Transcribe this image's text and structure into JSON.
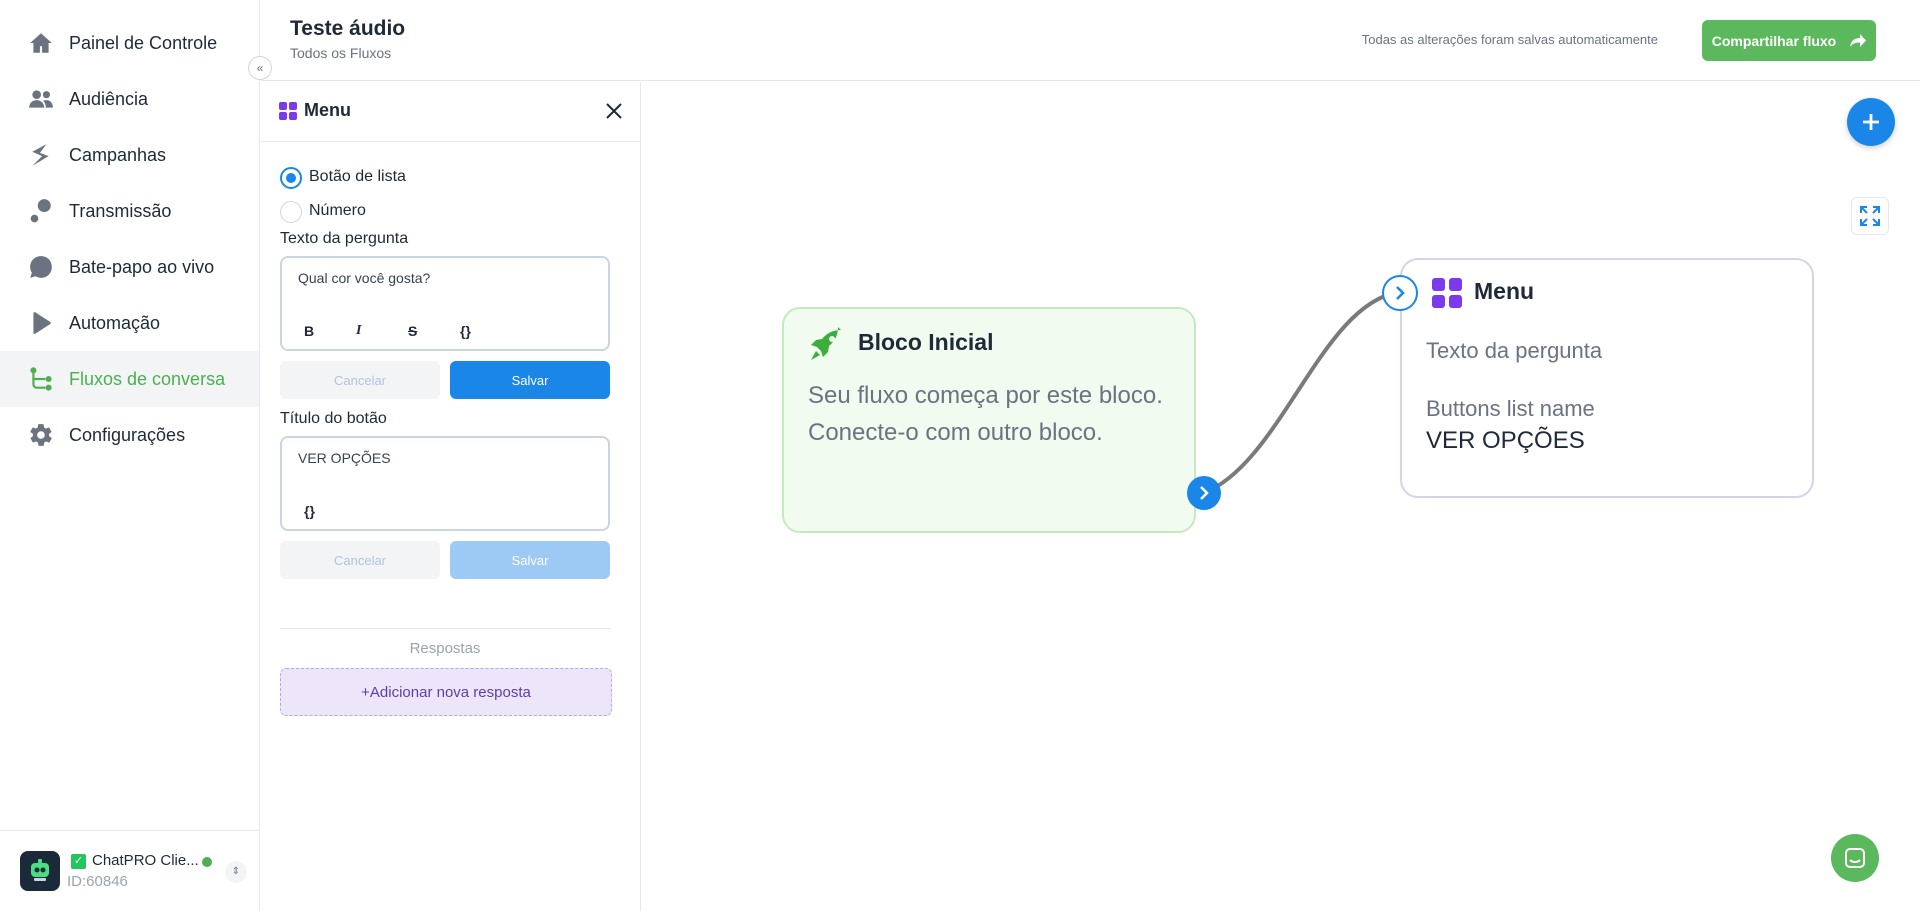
{
  "sidebar": {
    "items": [
      {
        "label": "Painel de Controle",
        "icon": "home-icon"
      },
      {
        "label": "Audiência",
        "icon": "people-icon"
      },
      {
        "label": "Campanhas",
        "icon": "campaigns-icon"
      },
      {
        "label": "Transmissão",
        "icon": "broadcast-icon"
      },
      {
        "label": "Bate-papo ao vivo",
        "icon": "chat-bubble-icon"
      },
      {
        "label": "Automação",
        "icon": "automation-icon"
      },
      {
        "label": "Fluxos de conversa",
        "icon": "flow-icon",
        "active": true
      },
      {
        "label": "Configurações",
        "icon": "gear-icon"
      }
    ],
    "account": {
      "name": "ChatPRO Clie...",
      "id": "ID:60846",
      "status_color": "#4caf50"
    }
  },
  "header": {
    "title": "Teste áudio",
    "breadcrumb": "Todos os Fluxos",
    "save_status": "Todas as alterações foram salvas automaticamente",
    "share_label": "Compartilhar fluxo"
  },
  "panel": {
    "title": "Menu",
    "options": {
      "list_button": "Botão de lista",
      "number": "Número",
      "selected": "Botão de lista"
    },
    "question": {
      "label": "Texto da pergunta",
      "value": "Qual cor você gosta?",
      "format_buttons": [
        "B",
        "I",
        "S",
        "{}"
      ],
      "cancel": "Cancelar",
      "save": "Salvar"
    },
    "button_title": {
      "label": "Título do botão",
      "value": "VER OPÇÕES",
      "format_buttons": [
        "{}"
      ],
      "cancel": "Cancelar",
      "save": "Salvar"
    },
    "responses_label": "Respostas",
    "add_response": "+Adicionar nova resposta"
  },
  "canvas": {
    "start_node": {
      "title": "Bloco Inicial",
      "description": "Seu fluxo começa por este bloco. Conecte-o com outro bloco."
    },
    "menu_node": {
      "title": "Menu",
      "question_label": "Texto da pergunta",
      "buttons_list_label": "Buttons list name",
      "buttons_list_value": "VER OPÇÕES"
    }
  },
  "colors": {
    "primary": "#1a86e8",
    "brand_green": "#5cb85c",
    "menu_purple": "#7c3aed"
  }
}
